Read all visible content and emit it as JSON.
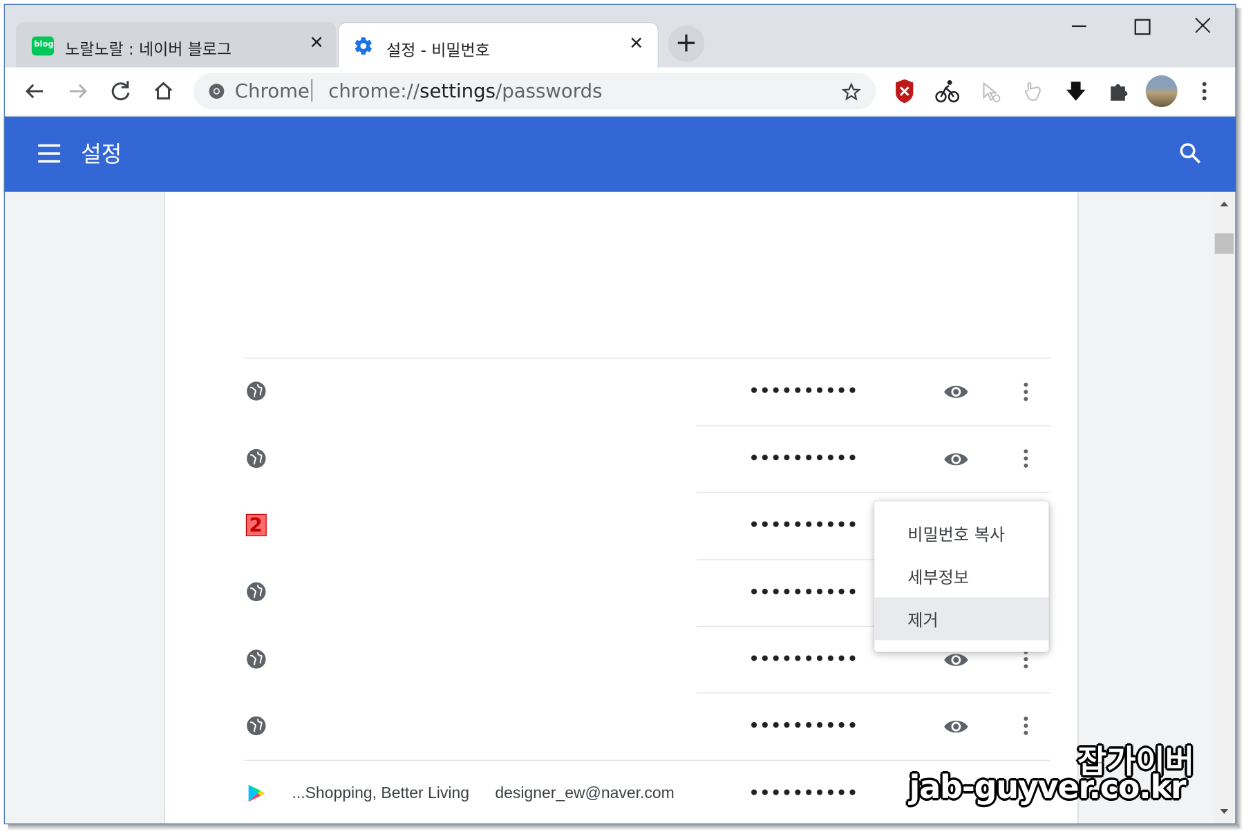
{
  "tabs": [
    {
      "title": "노랄노랄 : 네이버 블로그",
      "favicon": "blog",
      "favicon_color": "#03c75a",
      "close": "✕"
    },
    {
      "title": "설정 - 비밀번호",
      "favicon": "gear-icon",
      "favicon_color": "#1a73e8",
      "close": "✕"
    }
  ],
  "new_tab": "+",
  "window_controls": {
    "minimize": "—",
    "maximize": "☐",
    "close": "✕"
  },
  "omnibox": {
    "secure_label": "Chrome",
    "url_scheme": "chrome://",
    "url_host": "settings",
    "url_path": "/passwords"
  },
  "header": {
    "title": "설정",
    "color": "#3367d6"
  },
  "password_rows": [
    {
      "icon": "globe-icon",
      "password": "••••••••••"
    },
    {
      "icon": "globe-icon",
      "password": "••••••••••"
    },
    {
      "icon": "marker-2-icon",
      "marker": "2",
      "password": "••••••••••"
    },
    {
      "icon": "globe-icon",
      "password": "••••••••••"
    },
    {
      "icon": "globe-icon",
      "password": "••••••••••"
    },
    {
      "icon": "globe-icon",
      "password": "••••••••••"
    },
    {
      "icon": "play-store-icon",
      "site": "...Shopping, Better Living",
      "username": "designer_ew@naver.com",
      "password": "••••••••••"
    }
  ],
  "menu": {
    "items": [
      "비밀번호 복사",
      "세부정보",
      "제거"
    ],
    "highlighted": "제거"
  },
  "watermark": {
    "line1": "잡가이버",
    "line2": "jab-guyver.co.kr"
  }
}
